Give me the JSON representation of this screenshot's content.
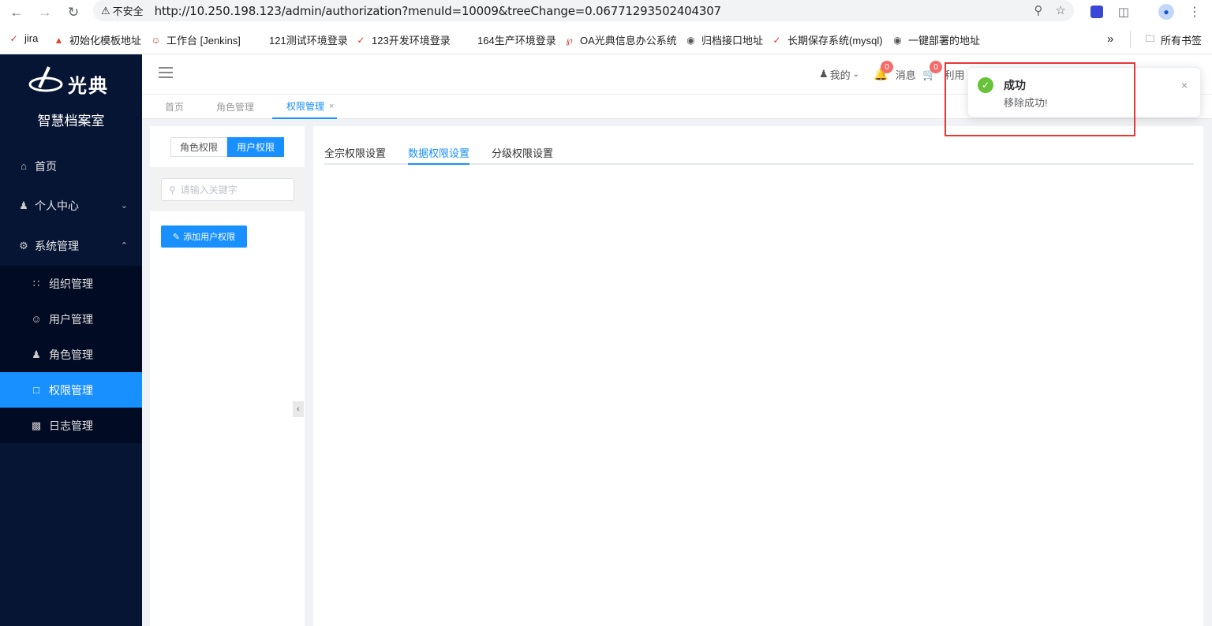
{
  "browser": {
    "security_label": "不安全",
    "url": "http://10.250.198.123/admin/authorization?menuId=10009&treeChange=0.06771293502404307"
  },
  "bookmarks": [
    {
      "label": "jira"
    },
    {
      "label": "初始化模板地址"
    },
    {
      "label": "工作台 [Jenkins]"
    },
    {
      "label": "121测试环境登录"
    },
    {
      "label": "123开发环境登录"
    },
    {
      "label": "164生产环境登录"
    },
    {
      "label": "OA光典信息办公系统"
    },
    {
      "label": "归档接口地址"
    },
    {
      "label": "长期保存系统(mysql)"
    },
    {
      "label": "一键部署的地址"
    },
    {
      "label": "所有书签"
    }
  ],
  "sidebar": {
    "logo_text": "光典",
    "brand": "智慧档案室",
    "items": [
      {
        "label": "首页",
        "icon": "home-icon"
      },
      {
        "label": "个人中心",
        "icon": "user-group-icon"
      },
      {
        "label": "系统管理",
        "icon": "gear-icon"
      }
    ],
    "subitems": [
      {
        "label": "组织管理",
        "icon": "org-icon"
      },
      {
        "label": "用户管理",
        "icon": "user-icon"
      },
      {
        "label": "角色管理",
        "icon": "role-icon"
      },
      {
        "label": "权限管理",
        "icon": "folder-icon"
      },
      {
        "label": "日志管理",
        "icon": "chart-icon"
      }
    ]
  },
  "header": {
    "mine": "我的",
    "messages": "消息",
    "messages_badge": "0",
    "cart_badge": "0",
    "utilize": "利用"
  },
  "tabs": [
    {
      "label": "首页"
    },
    {
      "label": "角色管理"
    },
    {
      "label": "权限管理"
    }
  ],
  "left_panel": {
    "seg_role": "角色权限",
    "seg_user": "用户权限",
    "search_placeholder": "请输入关键字",
    "add_button": "添加用户权限"
  },
  "right_panel": {
    "tabs": [
      {
        "label": "全宗权限设置"
      },
      {
        "label": "数据权限设置"
      },
      {
        "label": "分级权限设置"
      }
    ]
  },
  "toast": {
    "title": "成功",
    "message": "移除成功!"
  },
  "colors": {
    "accent": "#1890ff",
    "sidebar_bg": "#071535",
    "success": "#67c23a",
    "badge": "#f56c6c",
    "highlight": "#e53935"
  }
}
